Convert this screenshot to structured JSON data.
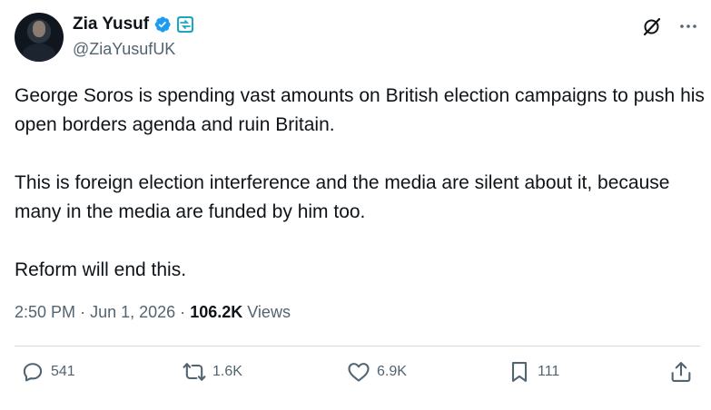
{
  "author": {
    "display_name": "Zia Yusuf",
    "handle": "@ZiaYusufUK"
  },
  "colors": {
    "verified_blue": "#1d9bf0",
    "text_primary": "#0f1419",
    "text_secondary": "#536471",
    "divider": "#cfd9de"
  },
  "tweet": {
    "paragraphs": [
      "George Soros is spending vast amounts on British election campaigns to push his open borders agenda and ruin Britain.",
      "This is foreign election interference and the media are silent about it, because many in the media are funded by him too.",
      "Reform will end this."
    ]
  },
  "meta": {
    "time": "2:50 PM",
    "separator": "·",
    "date": "Jun 1, 2026",
    "separator2": "·",
    "views_count": "106.2K",
    "views_label": "Views"
  },
  "actions": {
    "replies": "541",
    "reposts": "1.6K",
    "likes": "6.9K",
    "bookmarks": "111"
  },
  "icons": [
    "avatar",
    "verified-badge-icon",
    "affiliate-badge-icon",
    "grok-icon",
    "more-icon",
    "reply-icon",
    "retweet-icon",
    "like-icon",
    "bookmark-icon",
    "share-icon"
  ]
}
